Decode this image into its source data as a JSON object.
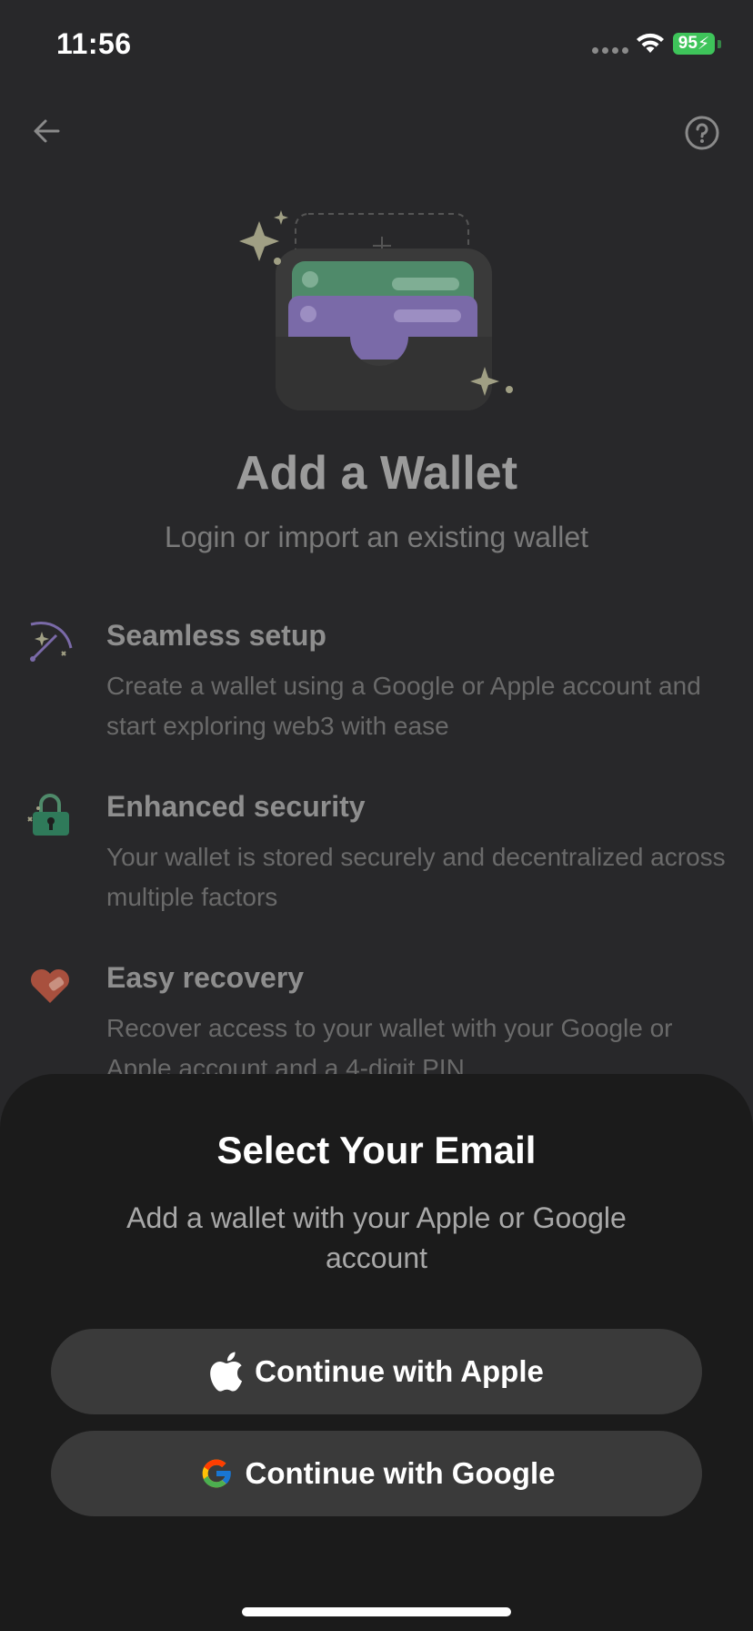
{
  "status_bar": {
    "time": "11:56",
    "battery_level": "95"
  },
  "nav": {
    "back_icon": "arrow-left-icon",
    "help_icon": "question-circle-icon"
  },
  "header": {
    "title": "Add a Wallet",
    "subtitle": "Login or import an existing wallet"
  },
  "features": [
    {
      "icon": "magic-wand-icon",
      "title": "Seamless setup",
      "description": "Create a wallet using a Google or Apple account and start exploring web3 with ease"
    },
    {
      "icon": "lock-icon",
      "title": "Enhanced security",
      "description": "Your wallet is stored securely and decentralized across multiple factors"
    },
    {
      "icon": "heart-bandage-icon",
      "title": "Easy recovery",
      "description": "Recover access to your wallet with your Google or Apple account and a 4-digit PIN"
    }
  ],
  "sheet": {
    "title": "Select Your Email",
    "description": "Add a wallet with your Apple or Google account",
    "apple_button": "Continue with Apple",
    "google_button": "Continue with Google"
  },
  "colors": {
    "battery": "#3ec45a",
    "wallet_green": "#4f8a6a",
    "wallet_purple": "#7a6aa8",
    "sheet_bg": "#1b1b1b",
    "button_bg": "#3a3a3a"
  }
}
